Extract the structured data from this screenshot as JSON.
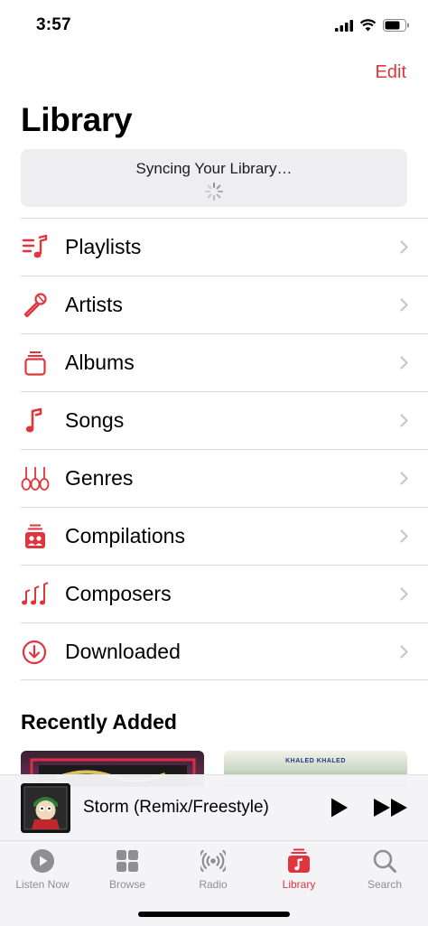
{
  "status_bar": {
    "time": "3:57"
  },
  "header": {
    "edit_label": "Edit",
    "title": "Library"
  },
  "sync": {
    "text": "Syncing Your Library…"
  },
  "library_items": [
    {
      "label": "Playlists",
      "icon": "playlist-icon"
    },
    {
      "label": "Artists",
      "icon": "microphone-icon"
    },
    {
      "label": "Albums",
      "icon": "album-stack-icon"
    },
    {
      "label": "Songs",
      "icon": "music-note-icon"
    },
    {
      "label": "Genres",
      "icon": "guitars-icon"
    },
    {
      "label": "Compilations",
      "icon": "compilation-icon"
    },
    {
      "label": "Composers",
      "icon": "music-notes-icon"
    },
    {
      "label": "Downloaded",
      "icon": "download-circle-icon"
    }
  ],
  "recently_added": {
    "title": "Recently Added",
    "albums": [
      {
        "art_text": ""
      },
      {
        "art_text": "KHALED KHALED"
      }
    ]
  },
  "mini_player": {
    "title": "Storm (Remix/Freestyle)"
  },
  "tabs": [
    {
      "label": "Listen Now",
      "icon": "play-circle-icon"
    },
    {
      "label": "Browse",
      "icon": "grid-icon"
    },
    {
      "label": "Radio",
      "icon": "radio-waves-icon"
    },
    {
      "label": "Library",
      "icon": "library-music-icon",
      "active": true
    },
    {
      "label": "Search",
      "icon": "magnifier-icon"
    }
  ],
  "colors": {
    "accent": "#e0353d",
    "inactive_tab": "#8e8e93",
    "separator": "#d9d9dd"
  }
}
